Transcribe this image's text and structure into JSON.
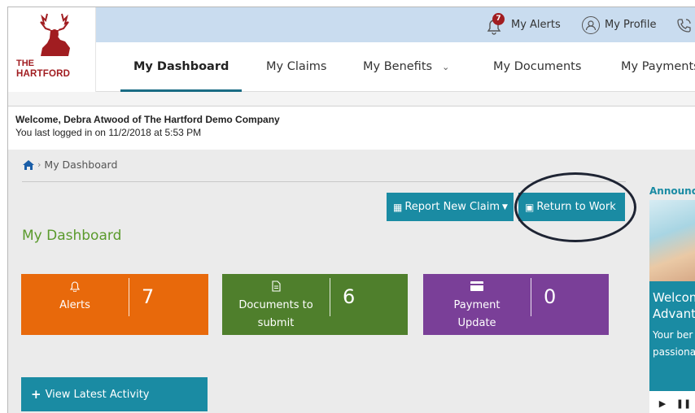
{
  "brand": {
    "line1": "THE",
    "line2": "HARTFORD"
  },
  "utility": {
    "alerts_label": "My Alerts",
    "alerts_badge": "7",
    "profile_label": "My Profile"
  },
  "nav": {
    "items": [
      {
        "label": "My Dashboard"
      },
      {
        "label": "My Claims"
      },
      {
        "label": "My Benefits"
      },
      {
        "label": "My Documents"
      },
      {
        "label": "My Payments"
      }
    ]
  },
  "welcome": {
    "line1": "Welcome, Debra Atwood of The Hartford Demo Company",
    "line2": "You last logged in on 11/2/2018 at 5:53 PM"
  },
  "breadcrumb": {
    "current": "My Dashboard"
  },
  "actions": {
    "report_label": "Report New Claim",
    "rtw_label": "Return to Work",
    "latest_label": "View Latest Activity"
  },
  "dashboard": {
    "title": "My Dashboard",
    "tiles": [
      {
        "label": "Alerts",
        "count": "7",
        "icon": "bell-icon",
        "color": "#e8690b"
      },
      {
        "label": "Documents to submit",
        "count": "6",
        "icon": "document-icon",
        "color": "#4f7f2c"
      },
      {
        "label": "Payment Update",
        "count": "0",
        "icon": "credit-card-icon",
        "color": "#7a3f98"
      }
    ]
  },
  "announcements": {
    "title": "Announc",
    "heading_line1": "Welcon",
    "heading_line2": "Advant",
    "body_line1": "Your ber",
    "body_line2": "passiona"
  },
  "colors": {
    "accent": "#1a8ba3",
    "brand_red": "#a11d21",
    "util_bar": "#c9dcef",
    "title_green": "#5a9a2c"
  }
}
